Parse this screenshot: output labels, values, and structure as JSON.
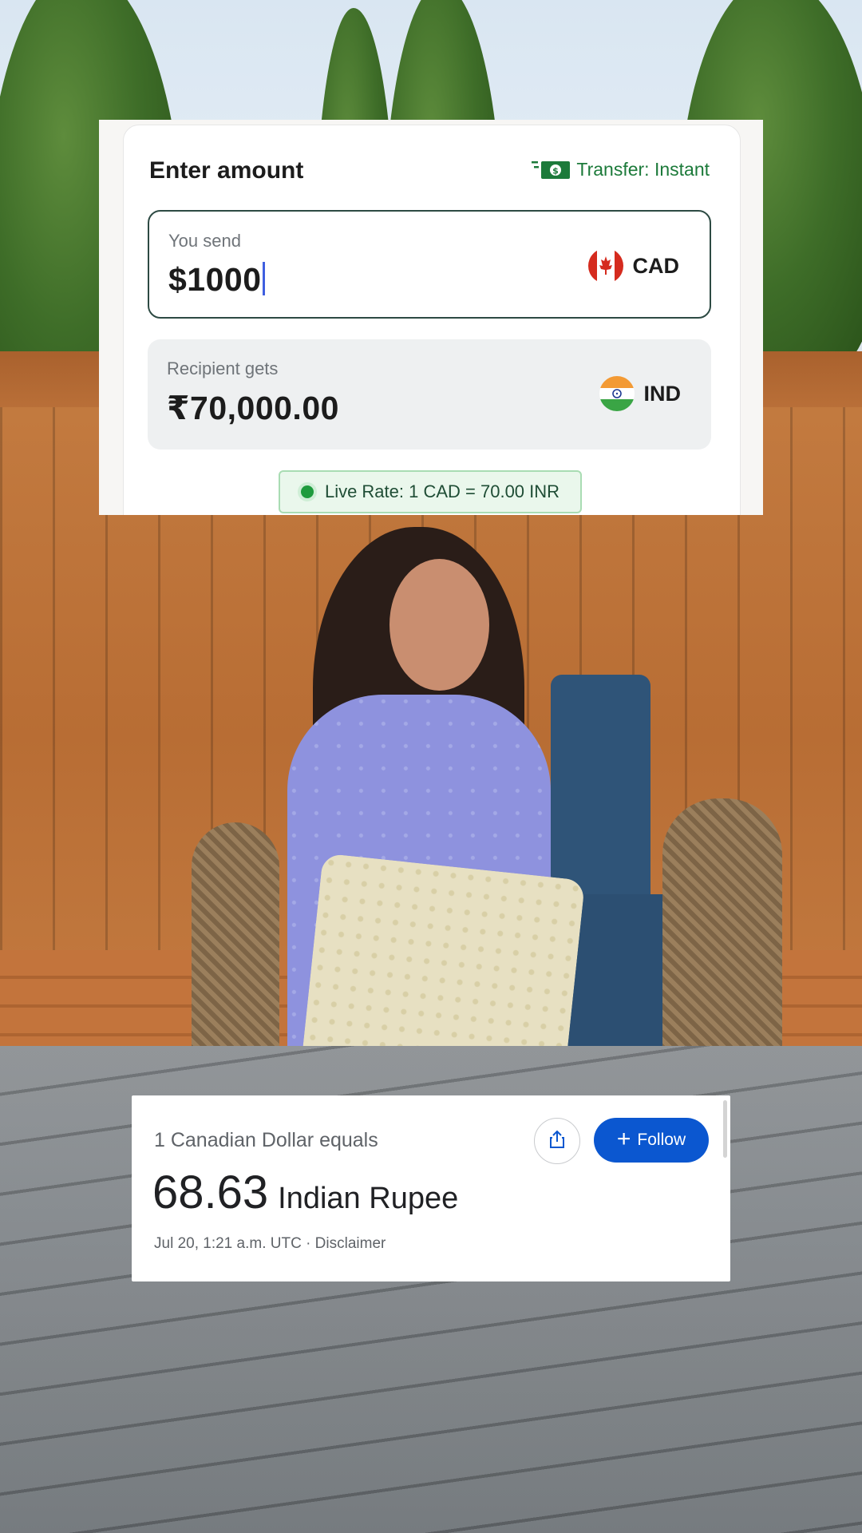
{
  "transfer_panel": {
    "title": "Enter amount",
    "transfer_label": "Transfer: Instant",
    "transfer_icon": "cash-icon",
    "send": {
      "label": "You send",
      "value": "$1000",
      "currency": "CAD",
      "flag_icon": "canada-flag-icon"
    },
    "receive": {
      "label": "Recipient gets",
      "value": "₹70,000.00",
      "currency": "IND",
      "flag_icon": "india-flag-icon"
    },
    "live_rate": "Live Rate: 1 CAD = 70.00 INR"
  },
  "google_card": {
    "equals_text": "1 Canadian Dollar equals",
    "rate_value": "68.63",
    "rate_unit": "Indian Rupee",
    "meta": "Jul 20, 1:21 a.m. UTC · Disclaimer",
    "share_icon": "share-icon",
    "follow_label": "Follow",
    "follow_icon": "plus-icon"
  },
  "colors": {
    "accent_green": "#1c7a3a",
    "follow_blue": "#0b57d0",
    "send_border": "#2d4a43",
    "caret": "#3f5fe0"
  }
}
